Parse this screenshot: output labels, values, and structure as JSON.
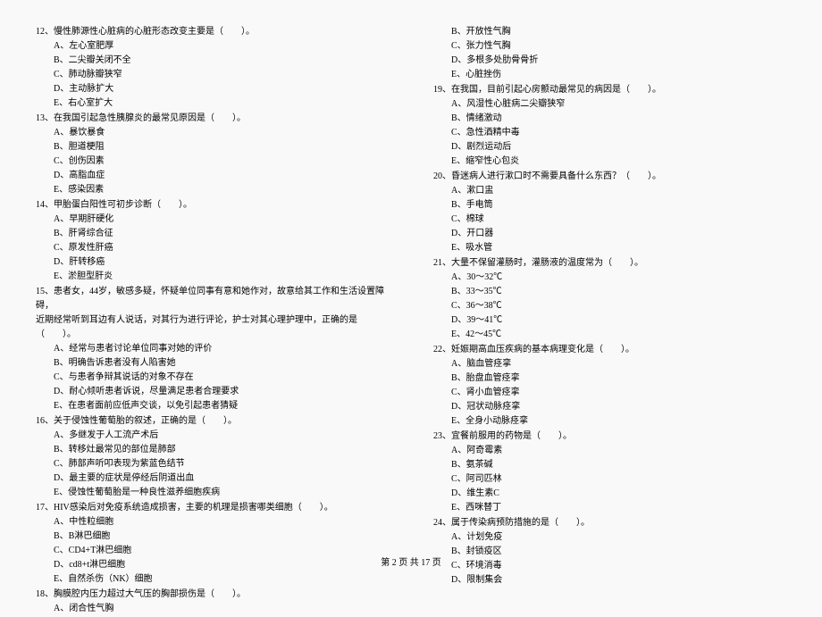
{
  "left": {
    "q12": {
      "stem": "12、慢性肺源性心脏病的心脏形态改变主要是（　　）。",
      "a": "A、左心室肥厚",
      "b": "B、二尖瓣关闭不全",
      "c": "C、肺动脉瓣狭窄",
      "d": "D、主动脉扩大",
      "e": "E、右心室扩大"
    },
    "q13": {
      "stem": "13、在我国引起急性胰腺炎的最常见原因是（　　）。",
      "a": "A、暴饮暴食",
      "b": "B、胆道梗阻",
      "c": "C、创伤因素",
      "d": "D、高脂血症",
      "e": "E、感染因素"
    },
    "q14": {
      "stem": "14、甲胎蛋白阳性可初步诊断（　　）。",
      "a": "A、早期肝硬化",
      "b": "B、肝肾综合征",
      "c": "C、原发性肝癌",
      "d": "D、肝转移癌",
      "e": "E、淤胆型肝炎"
    },
    "q15": {
      "stem1": "15、患者女，44岁，敏感多疑，怀疑单位同事有意和她作对，故意给其工作和生活设置障碍，",
      "stem2": "近期经常听到耳边有人说话，对其行为进行评论，护士对其心理护理中，正确的是（　　）。",
      "a": "A、经常与患者讨论单位同事对她的评价",
      "b": "B、明确告诉患者没有人陷害她",
      "c": "C、与患者争辩其说话的对象不存在",
      "d": "D、耐心倾听患者诉说，尽量满足患者合理要求",
      "e": "E、在患者面前应低声交谈，以免引起患者猜疑"
    },
    "q16": {
      "stem": "16、关于侵蚀性葡萄胎的叙述，正确的是（　　）。",
      "a": "A、多继发于人工流产术后",
      "b": "B、转移灶最常见的部位是肺部",
      "c": "C、肺部声听叩表现为紫蓝色结节",
      "d": "D、最主要的症状是停经后阴道出血",
      "e": "E、侵蚀性葡萄胎是一种良性滋养细胞疾病"
    },
    "q17": {
      "stem": "17、HIV感染后对免疫系统造成损害，主要的机理是损害哪类细胞（　　）。",
      "a": "A、中性粒细胞",
      "b": "B、B淋巴细胞",
      "c": "C、CD4+T淋巴细胞",
      "d": "D、cd8+t淋巴细胞",
      "e": "E、自然杀伤（NK）细胞"
    },
    "q18": {
      "stem": "18、胸膜腔内压力超过大气压的胸部损伤是（　　）。",
      "a": "A、闭合性气胸"
    }
  },
  "right": {
    "q18r": {
      "b": "B、开放性气胸",
      "c": "C、张力性气胸",
      "d": "D、多根多处肋骨骨折",
      "e": "E、心脏挫伤"
    },
    "q19": {
      "stem": "19、在我国，目前引起心房颤动最常见的病因是（　　）。",
      "a": "A、风湿性心脏病二尖瓣狭窄",
      "b": "B、情绪激动",
      "c": "C、急性酒精中毒",
      "d": "D、剧烈运动后",
      "e": "E、缩窄性心包炎"
    },
    "q20": {
      "stem": "20、昏迷病人进行漱口时不需要具备什么东西？（　　）。",
      "a": "A、漱口盅",
      "b": "B、手电筒",
      "c": "C、棉球",
      "d": "D、开口器",
      "e": "E、吸水管"
    },
    "q21": {
      "stem": "21、大量不保留灌肠时，灌肠液的温度常为（　　）。",
      "a": "A、30～32℃",
      "b": "B、33～35℃",
      "c": "C、36～38℃",
      "d": "D、39～41℃",
      "e": "E、42～45℃"
    },
    "q22": {
      "stem": "22、妊娠期高血压疾病的基本病理变化是（　　）。",
      "a": "A、脑血管痉挛",
      "b": "B、胎盘血管痉挛",
      "c": "C、肾小血管痉挛",
      "d": "D、冠状动脉痉挛",
      "e": "E、全身小动脉痉挛"
    },
    "q23": {
      "stem": "23、宜餐前服用的药物是（　　）。",
      "a": "A、阿奇霉素",
      "b": "B、氨茶碱",
      "c": "C、阿司匹林",
      "d": "D、维生素C",
      "e": "E、西咪替丁"
    },
    "q24": {
      "stem": "24、属于传染病预防措施的是（　　）。",
      "a": "A、计划免疫",
      "b": "B、封锁疫区",
      "c": "C、环境消毒",
      "d": "D、限制集会"
    }
  },
  "footer": "第 2 页 共 17 页"
}
